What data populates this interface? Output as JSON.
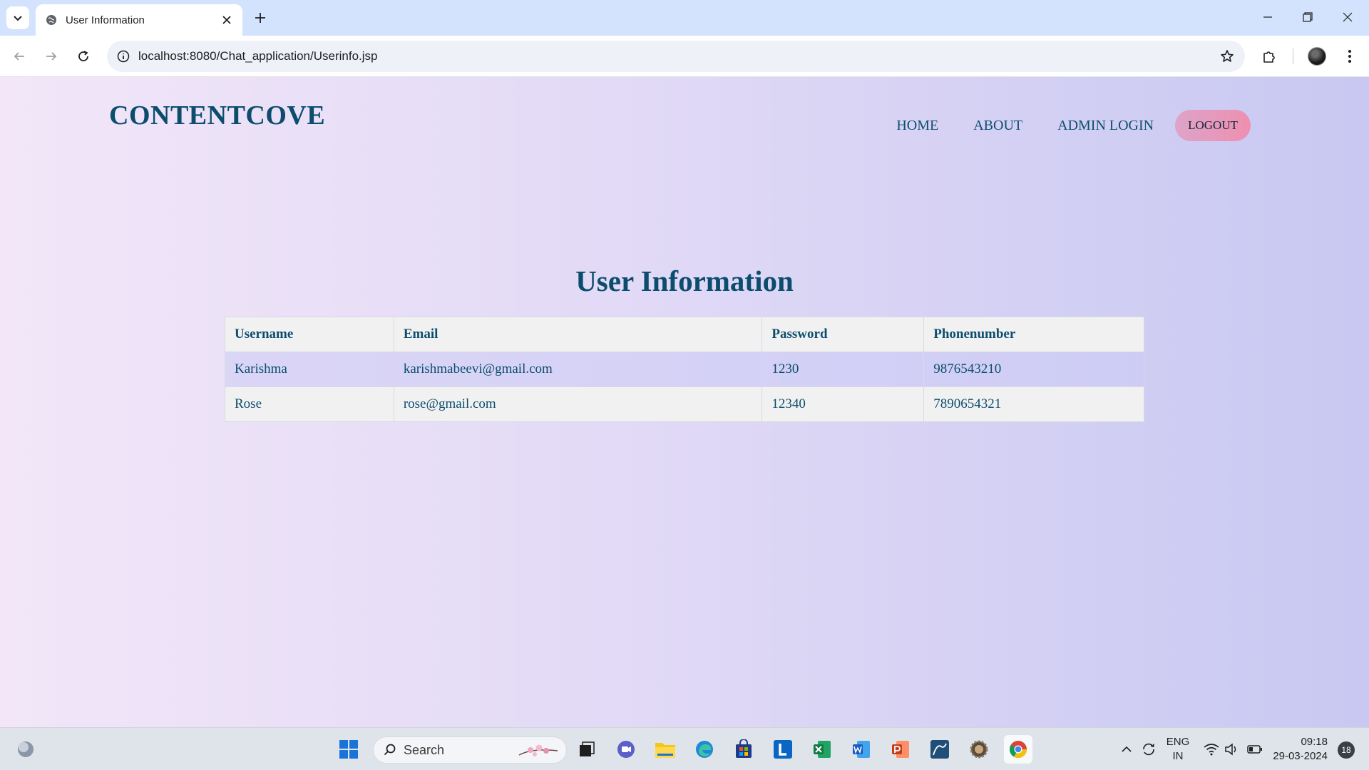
{
  "browser": {
    "tab_title": "User Information",
    "url": "localhost:8080/Chat_application/Userinfo.jsp"
  },
  "site": {
    "brand": "CONTENTCOVE",
    "nav": [
      {
        "label": "HOME"
      },
      {
        "label": "ABOUT"
      },
      {
        "label": "ADMIN LOGIN"
      }
    ],
    "logout_label": "LOGOUT"
  },
  "main": {
    "heading": "User Information",
    "columns": [
      "Username",
      "Email",
      "Password",
      "Phonenumber"
    ],
    "rows": [
      [
        "Karishma",
        "karishmabeevi@gmail.com",
        "1230",
        "9876543210"
      ],
      [
        "Rose",
        "rose@gmail.com",
        "12340",
        "7890654321"
      ]
    ]
  },
  "taskbar": {
    "search_placeholder": "Search",
    "lang_line1": "ENG",
    "lang_line2": "IN",
    "time": "09:18",
    "date": "29-03-2024",
    "notification_count": "18"
  },
  "colors": {
    "brand": "#0c4d6e",
    "logout_button": "#ee8fb0",
    "tab_strip": "#d3e3fd"
  }
}
